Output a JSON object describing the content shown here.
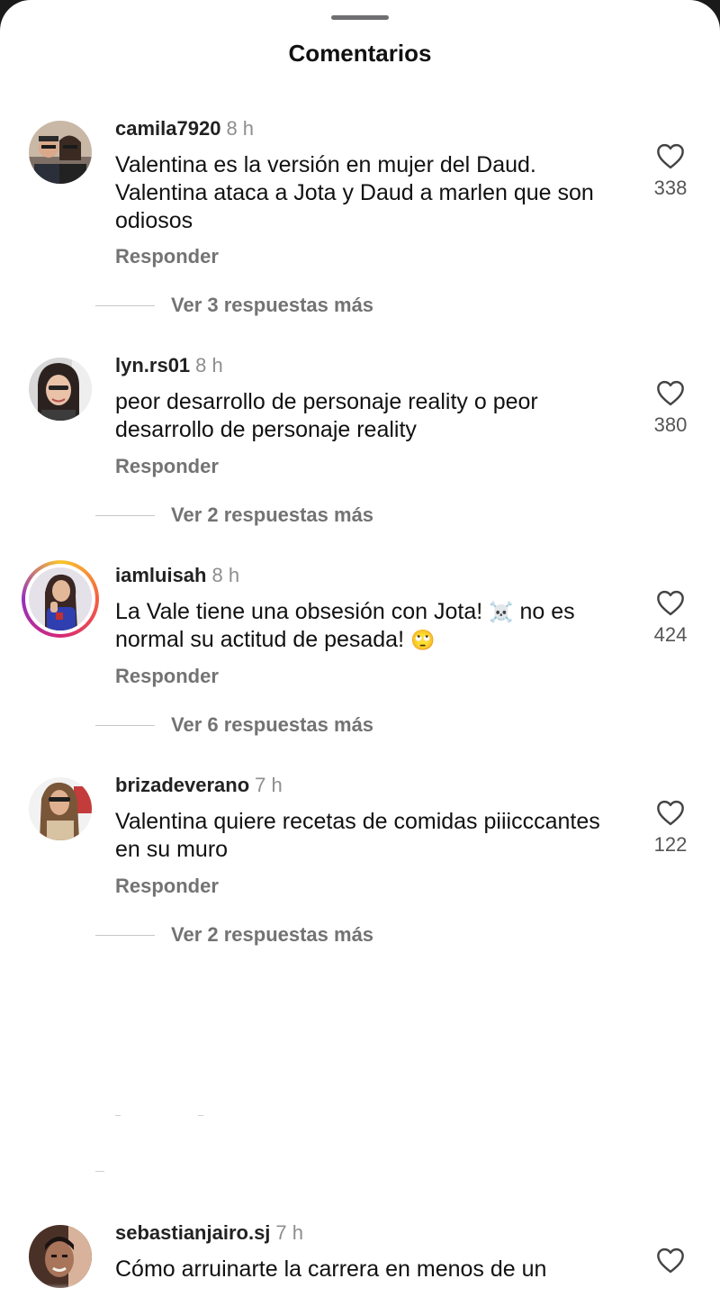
{
  "sheet": {
    "title": "Comentarios"
  },
  "comments": [
    {
      "username": "camila7920",
      "time": "8 h",
      "text": "Valentina es la versión en mujer del Daud. Valentina ataca a Jota y Daud a marlen que son odiosos",
      "reply_label": "Responder",
      "more_replies": "Ver 3 respuestas más",
      "likes": "338"
    },
    {
      "username": "lyn.rs01",
      "time": "8 h",
      "text": "peor desarrollo de personaje reality o peor desarrollo de personaje reality",
      "reply_label": "Responder",
      "more_replies": "Ver 2 respuestas más",
      "likes": "380"
    },
    {
      "username": "iamluisah",
      "time": "8 h",
      "text_part1": "La Vale tiene una obsesión con Jota! ",
      "emoji1": "☠️",
      "text_part2": " no es normal su actitud de pesada! ",
      "emoji2": "🙄",
      "reply_label": "Responder",
      "more_replies": "Ver 6 respuestas más",
      "likes": "424"
    },
    {
      "username": "brizadeverano",
      "time": "7 h",
      "text": "Valentina quiere recetas de comidas piiicccantes en su muro",
      "reply_label": "Responder",
      "more_replies": "Ver 2 respuestas más",
      "likes": "122"
    },
    {
      "username": "sebastianjairo.sj",
      "time": "7 h",
      "text": "Cómo arruinarte la carrera en menos de un"
    }
  ],
  "icons": {
    "like": "heart-outline-icon"
  }
}
